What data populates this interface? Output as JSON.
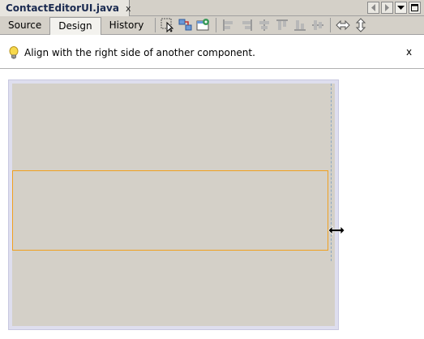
{
  "file_tab": {
    "name": "ContactEditorUI.java",
    "close_label": "x"
  },
  "view_tabs": [
    "Source",
    "Design",
    "History"
  ],
  "active_view": "Design",
  "toolbar_icons": [
    "selection-mode-icon",
    "connection-mode-icon",
    "preview-design-icon",
    "align-left-icon",
    "align-right-icon",
    "center-horizontally-icon",
    "align-top-icon",
    "align-bottom-icon",
    "center-vertically-icon",
    "horizontal-resize-icon",
    "vertical-resize-icon"
  ],
  "hint": {
    "text": "Align with the right side of another component.",
    "close_label": "x"
  },
  "colors": {
    "canvas_bg": "#d4d0c8",
    "component_border": "#f0a020",
    "guide_line": "#8aa6c4"
  }
}
